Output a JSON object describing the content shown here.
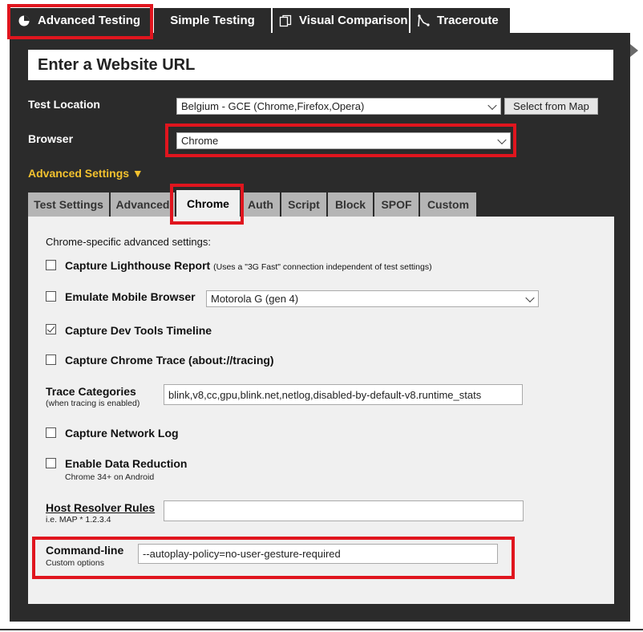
{
  "top_tabs": {
    "advanced": "Advanced Testing",
    "simple": "Simple Testing",
    "visual": "Visual Comparison",
    "traceroute": "Traceroute"
  },
  "url_header": "Enter a Website URL",
  "test_location": {
    "label": "Test Location",
    "value": "Belgium - GCE (Chrome,Firefox,Opera)",
    "map_button": "Select from Map"
  },
  "browser": {
    "label": "Browser",
    "value": "Chrome"
  },
  "advanced_settings": "Advanced Settings ▼",
  "settings_tabs": [
    "Test Settings",
    "Advanced",
    "Chrome",
    "Auth",
    "Script",
    "Block",
    "SPOF",
    "Custom"
  ],
  "chrome": {
    "intro": "Chrome-specific advanced settings:",
    "lighthouse": {
      "label": "Capture Lighthouse Report",
      "note": "(Uses a \"3G Fast\" connection independent of test settings)",
      "checked": false
    },
    "emulate": {
      "label": "Emulate Mobile Browser",
      "device": "Motorola G (gen 4)",
      "checked": false
    },
    "devtools": {
      "label": "Capture Dev Tools Timeline",
      "checked": true
    },
    "trace": {
      "label": "Capture Chrome Trace (about://tracing)",
      "checked": false
    },
    "trace_categories": {
      "label": "Trace Categories",
      "note": "(when tracing is enabled)",
      "value": "blink,v8,cc,gpu,blink.net,netlog,disabled-by-default-v8.runtime_stats"
    },
    "netlog": {
      "label": "Capture Network Log",
      "checked": false
    },
    "data_reduction": {
      "label": "Enable Data Reduction",
      "note": "Chrome 34+ on Android",
      "checked": false
    },
    "host_resolver": {
      "label": "Host Resolver Rules",
      "note": "i.e. MAP * 1.2.3.4",
      "value": ""
    },
    "command_line": {
      "label": "Command-line",
      "note": "Custom options",
      "value": "--autoplay-policy=no-user-gesture-required"
    }
  },
  "colors": {
    "panel": "#2b2b2b",
    "highlight": "#e0151e",
    "accent": "#f2c12e",
    "content_bg": "#f0f0f0"
  }
}
